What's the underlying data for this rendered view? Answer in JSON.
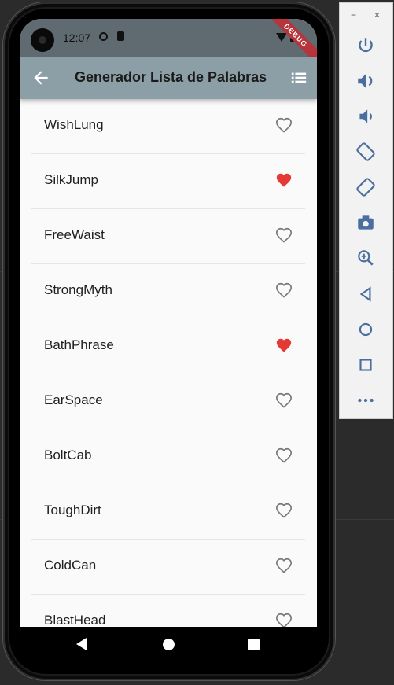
{
  "status_bar": {
    "time": "12:07",
    "debug_banner": "DEBUG"
  },
  "app_bar": {
    "title": "Generador Lista de Palabras"
  },
  "words": [
    {
      "label": "WishLung",
      "favorite": false
    },
    {
      "label": "SilkJump",
      "favorite": true
    },
    {
      "label": "FreeWaist",
      "favorite": false
    },
    {
      "label": "StrongMyth",
      "favorite": false
    },
    {
      "label": "BathPhrase",
      "favorite": true
    },
    {
      "label": "EarSpace",
      "favorite": false
    },
    {
      "label": "BoltCab",
      "favorite": false
    },
    {
      "label": "ToughDirt",
      "favorite": false
    },
    {
      "label": "ColdCan",
      "favorite": false
    },
    {
      "label": "BlastHead",
      "favorite": false
    }
  ],
  "emulator_panel": {
    "window_controls": {
      "minimize": "−",
      "close": "×"
    },
    "tools": [
      "power-icon",
      "volume-up-icon",
      "volume-down-icon",
      "rotate-left-icon",
      "rotate-right-icon",
      "camera-icon",
      "zoom-icon",
      "back-icon",
      "home-icon",
      "overview-icon",
      "more-icon"
    ]
  },
  "colors": {
    "favorite": "#e53935",
    "outline": "#777777",
    "app_bar": "#8c9ea6",
    "status_bar": "#606b71"
  }
}
